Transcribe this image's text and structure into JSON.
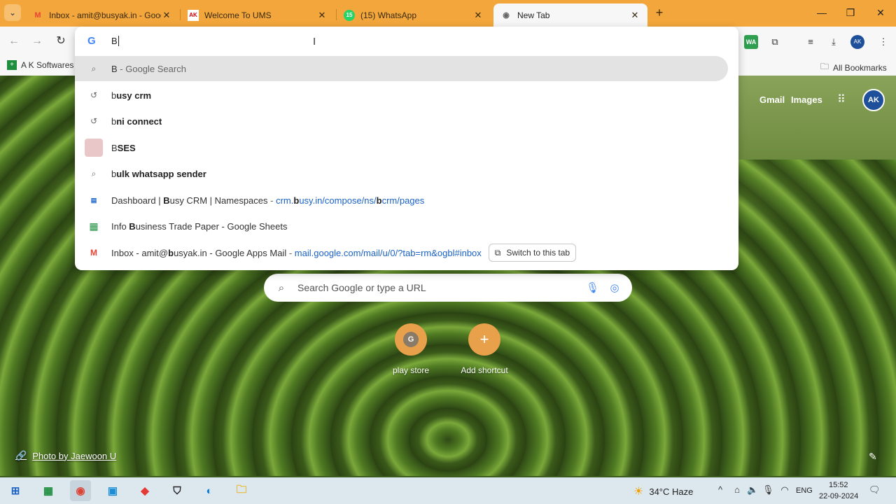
{
  "tabs": [
    {
      "title": "Inbox - amit@busyak.in - Goog",
      "favicon": "gmail-icon"
    },
    {
      "title": "Welcome To UMS",
      "favicon": "ums-icon"
    },
    {
      "title": "(15) WhatsApp",
      "favicon": "whatsapp-icon"
    },
    {
      "title": "New Tab",
      "favicon": "chrome-icon"
    }
  ],
  "bookmarks": {
    "first": "A K Softwares A",
    "all": "All Bookmarks"
  },
  "omnibox": {
    "value": "B",
    "suggestions": [
      {
        "icon": "search-icon",
        "pre": "B",
        "bold": "",
        "post": "",
        "sub": " - Google Search"
      },
      {
        "icon": "history-icon",
        "pre": "b",
        "bold": "usy crm",
        "post": ""
      },
      {
        "icon": "history-icon",
        "pre": "b",
        "bold": "ni connect",
        "post": ""
      },
      {
        "icon": "bses-icon",
        "pre": "B",
        "bold": "SES",
        "post": ""
      },
      {
        "icon": "search-icon",
        "pre": "b",
        "bold": "ulk whatsapp sender",
        "post": ""
      },
      {
        "icon": "busy-icon",
        "pre": "Dashboard | ",
        "bold": "B",
        "post": "usy CRM | Namespaces",
        "url_pre": "crm.",
        "url_bold": "b",
        "url_mid": "usy.in/compose/ns/",
        "url_bold2": "b",
        "url_post": "crm/pages"
      },
      {
        "icon": "sheets-icon",
        "pre": "Info ",
        "bold": "B",
        "post": "usiness Trade Paper - Google Sheets"
      },
      {
        "icon": "gmail-icon",
        "pre": "Inbox - amit@",
        "bold": "b",
        "post": "usyak.in - Google Apps Mail",
        "url": "mail.google.com/mail/u/0/?tab=rm&ogbl#inbox",
        "button": "Switch to this tab"
      }
    ]
  },
  "ntp": {
    "gmail": "Gmail",
    "images": "Images",
    "avatar": "AK",
    "search_placeholder": "Search Google or type a URL",
    "shortcuts": [
      {
        "label": "play store",
        "letter": "G"
      },
      {
        "label": "Add shortcut",
        "letter": "+"
      }
    ],
    "photo_credit": "Photo by Jaewoon U"
  },
  "taskbar": {
    "weather": "34°C  Haze",
    "lang": "ENG",
    "time": "15:52",
    "date": "22-09-2024"
  },
  "colors": {
    "tabstrip": "#f2a63b",
    "accent": "#1a62c7"
  }
}
